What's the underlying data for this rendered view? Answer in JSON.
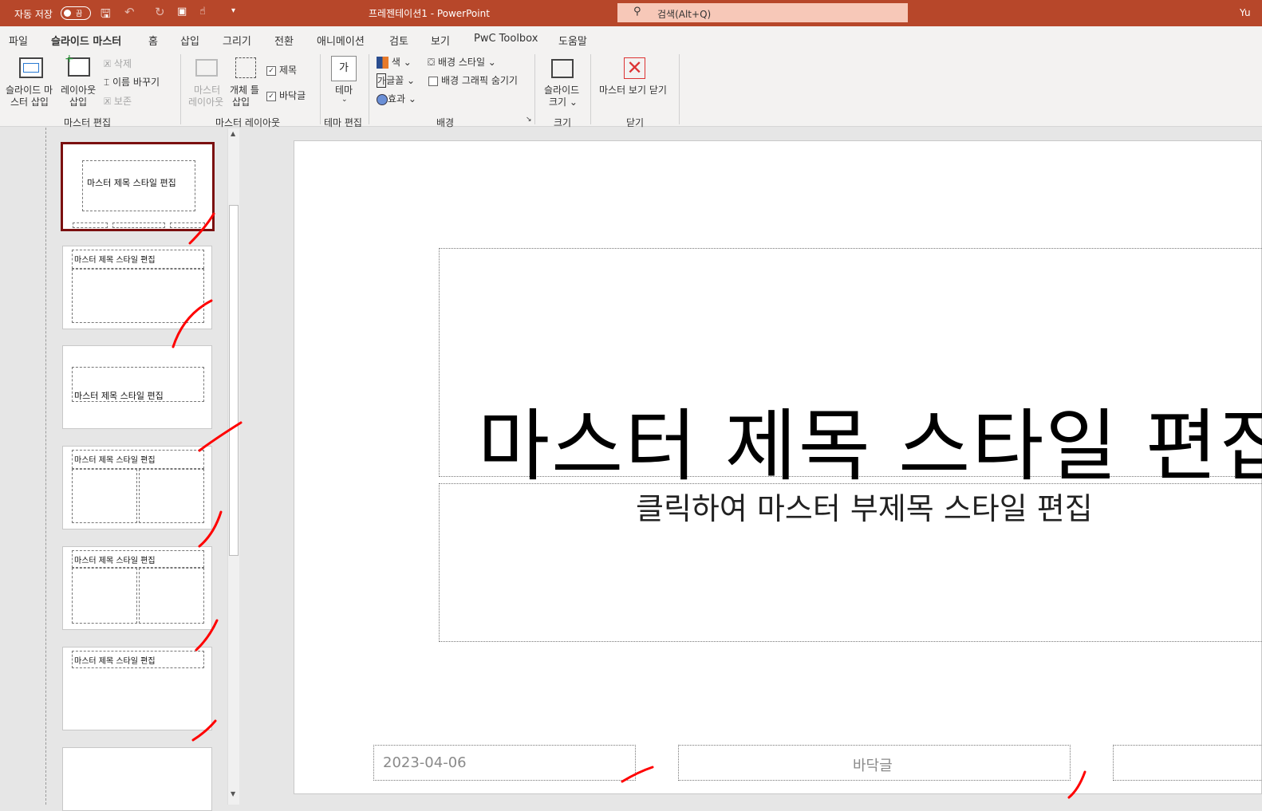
{
  "titlebar": {
    "autosave": "자동 저장",
    "toggle": "끔",
    "doc_title": "프레젠테이션1  -  PowerPoint",
    "search_placeholder": "검색(Alt+Q)",
    "user": "Yu"
  },
  "tabs": [
    "파일",
    "슬라이드 마스터",
    "홈",
    "삽입",
    "그리기",
    "전환",
    "애니메이션",
    "검토",
    "보기",
    "PwC Toolbox",
    "도움말"
  ],
  "ribbon": {
    "insert_master": [
      "슬라이드 마",
      "스터 삽입"
    ],
    "insert_layout": [
      "레이아웃",
      "삽입"
    ],
    "delete": "삭제",
    "rename": "이름 바꾸기",
    "preserve": "보존",
    "master_layout": [
      "마스터",
      "레이아웃"
    ],
    "placeholder": [
      "개체 틀",
      "삽입"
    ],
    "title_cb": "제목",
    "footer_cb": "바닥글",
    "theme": "테마",
    "colors": "색",
    "fonts": "글꼴",
    "effects": "효과",
    "bg_style": "배경 스타일",
    "hide_bg": "배경 그래픽 숨기기",
    "slide_size": [
      "슬라이드",
      "크기"
    ],
    "close_master": "마스터 보기 닫기",
    "groups": [
      "마스터 편집",
      "마스터 레이아웃",
      "테마 편집",
      "배경",
      "크기",
      "닫기"
    ]
  },
  "thumbs": {
    "title": "마스터 제목 스타일 편집"
  },
  "slide": {
    "title": "마스터 제목 스타일 편집",
    "subtitle": "클릭하여 마스터 부제목 스타일 편집",
    "date": "2023-04-06",
    "footer": "바닥글"
  },
  "colors": {
    "accent": "#b7472a",
    "selected": "#7b1010",
    "annotation": "#ff0000"
  }
}
